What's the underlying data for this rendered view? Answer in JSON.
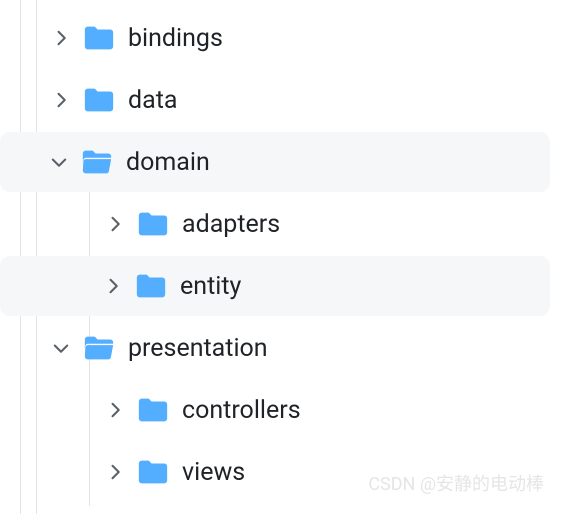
{
  "tree": {
    "nodes": [
      {
        "id": "bindings",
        "label": "bindings",
        "expanded": false,
        "indent": 0,
        "highlight": false,
        "open": false
      },
      {
        "id": "data",
        "label": "data",
        "expanded": false,
        "indent": 0,
        "highlight": false,
        "open": false
      },
      {
        "id": "domain",
        "label": "domain",
        "expanded": true,
        "indent": 0,
        "highlight": true,
        "open": true
      },
      {
        "id": "adapters",
        "label": "adapters",
        "expanded": false,
        "indent": 1,
        "highlight": false,
        "open": false
      },
      {
        "id": "entity",
        "label": "entity",
        "expanded": false,
        "indent": 1,
        "highlight": true,
        "open": false
      },
      {
        "id": "presentation",
        "label": "presentation",
        "expanded": true,
        "indent": 0,
        "highlight": false,
        "open": true
      },
      {
        "id": "controllers",
        "label": "controllers",
        "expanded": false,
        "indent": 1,
        "highlight": false,
        "open": false
      },
      {
        "id": "views",
        "label": "views",
        "expanded": false,
        "indent": 1,
        "highlight": false,
        "open": false
      }
    ]
  },
  "watermark": "CSDN @安静的电动棒"
}
